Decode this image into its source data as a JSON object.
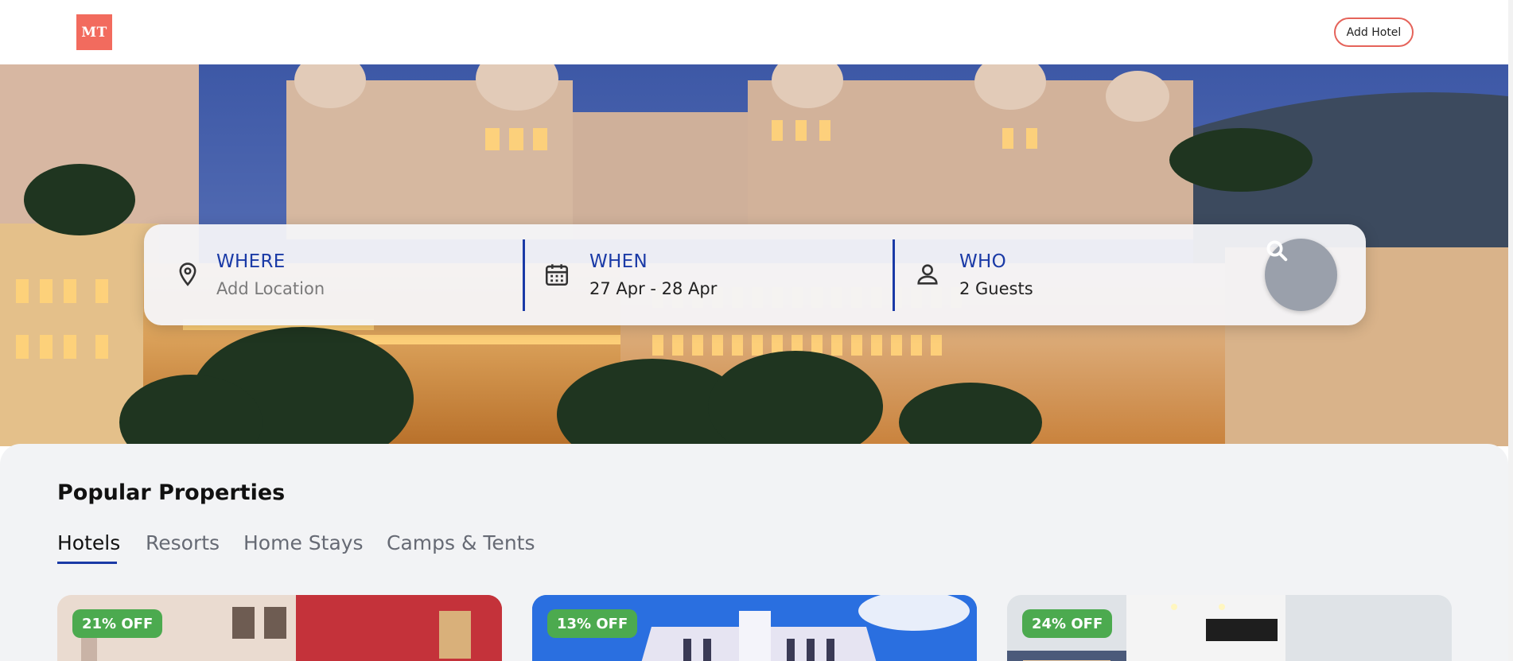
{
  "header": {
    "logo_text": "MT",
    "add_hotel_label": "Add Hotel"
  },
  "search": {
    "where": {
      "label": "WHERE",
      "placeholder": "Add Location"
    },
    "when": {
      "label": "WHEN",
      "value": "27 Apr - 28 Apr"
    },
    "who": {
      "label": "WHO",
      "value": "2 Guests"
    }
  },
  "popular": {
    "title": "Popular Properties",
    "tabs": [
      "Hotels",
      "Resorts",
      "Home Stays",
      "Camps & Tents"
    ],
    "active_tab": "Hotels",
    "cards": [
      {
        "badge": "21% OFF"
      },
      {
        "badge": "13% OFF"
      },
      {
        "badge": "24% OFF"
      }
    ]
  },
  "colors": {
    "brand": "#f26b5e",
    "accent": "#1a3aa6",
    "discount": "#4caa4f"
  }
}
